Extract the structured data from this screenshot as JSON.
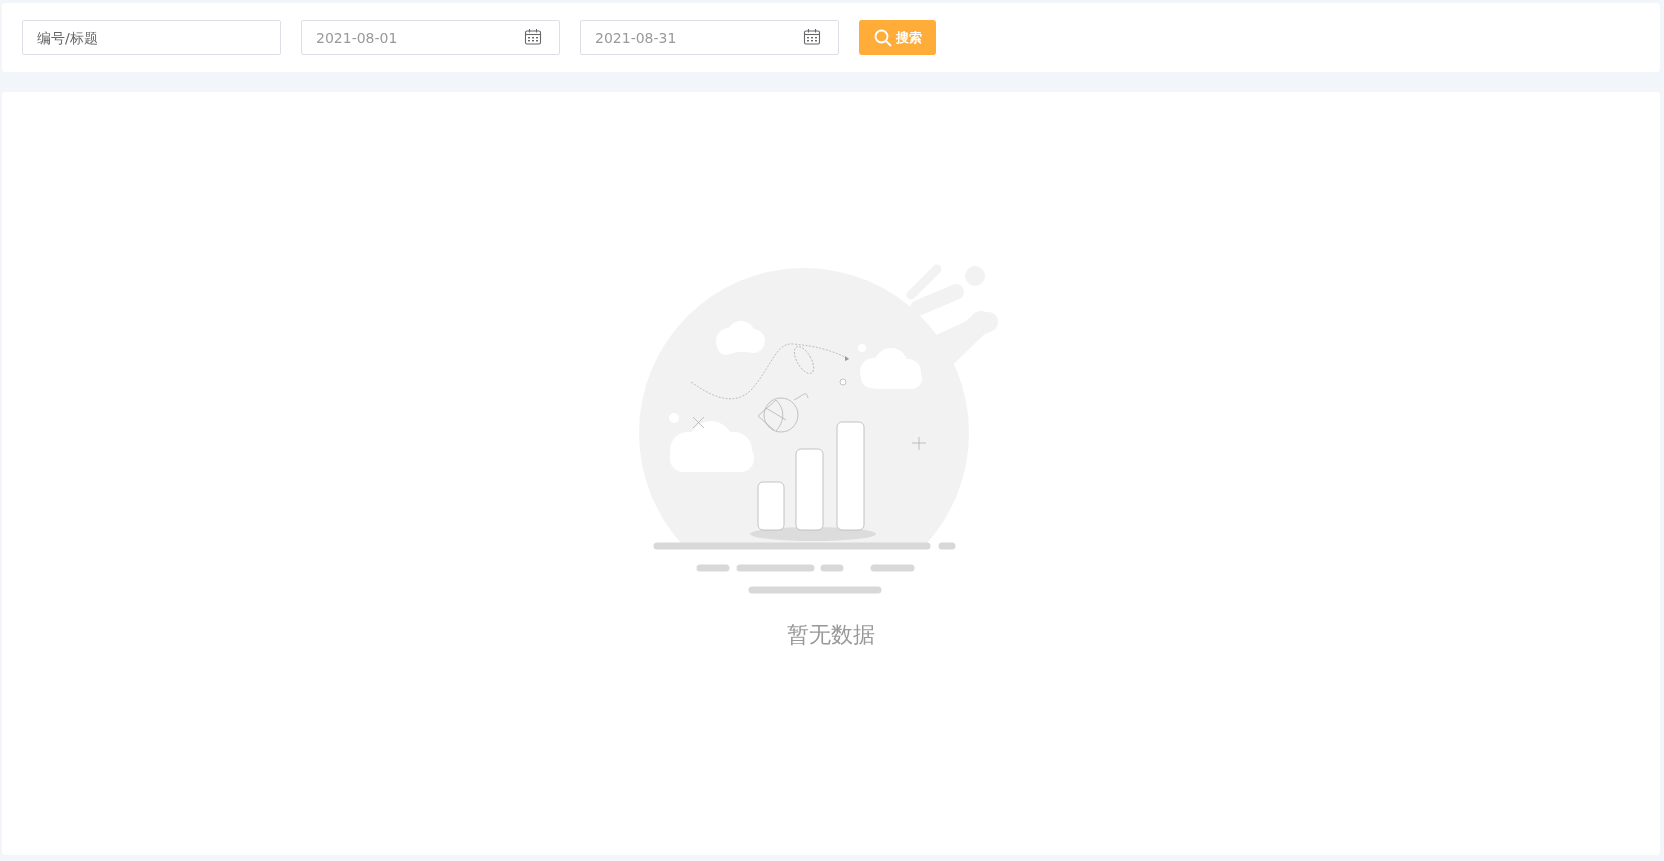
{
  "search": {
    "placeholder": "编号/标题"
  },
  "date_range": [
    {
      "value": "2021-08-01"
    },
    {
      "value": "2021-08-31"
    }
  ],
  "search_button": {
    "label": "搜索"
  },
  "empty_state": {
    "message": "暂无数据"
  }
}
